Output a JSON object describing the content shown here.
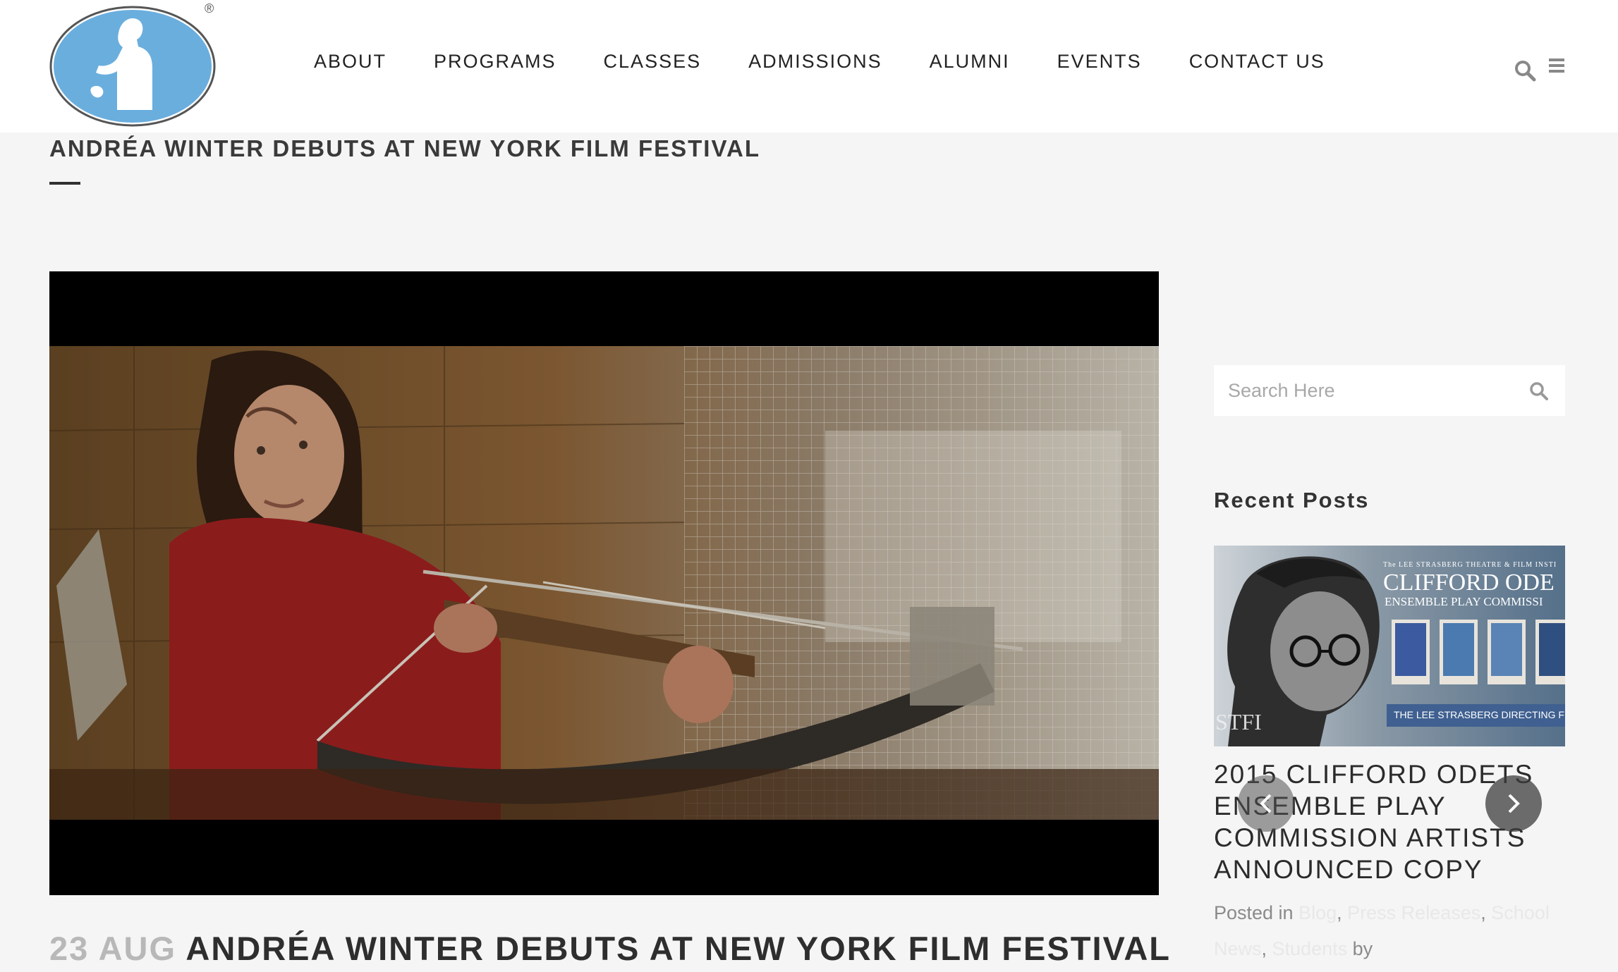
{
  "brand": {
    "logo_registered_mark": "®",
    "accent_color": "#6aaede"
  },
  "nav": {
    "items": [
      {
        "label": "ABOUT"
      },
      {
        "label": "PROGRAMS"
      },
      {
        "label": "CLASSES"
      },
      {
        "label": "ADMISSIONS"
      },
      {
        "label": "ALUMNI"
      },
      {
        "label": "EVENTS"
      },
      {
        "label": "CONTACT US"
      }
    ],
    "search_icon": "search-icon",
    "menu_icon": "hamburger-menu-icon"
  },
  "page": {
    "title": "ANDRÉA WINTER DEBUTS AT NEW YORK FILM FESTIVAL"
  },
  "post": {
    "date_day": "23 AUG",
    "title": "ANDRÉA WINTER DEBUTS AT NEW YORK FILM FESTIVAL"
  },
  "sidebar": {
    "search": {
      "placeholder": "Search Here"
    },
    "recent_posts": {
      "heading": "Recent Posts",
      "thumb": {
        "headline": "CLIFFORD ODE",
        "subheadline": "ENSEMBLE PLAY COMMISSI",
        "banner": "THE LEE STRASBERG DIRECTING FELLOWS",
        "org_small": "The LEE STRASBERG THEATRE & FILM INSTI",
        "watermark": "STFI"
      },
      "item_title": "2015 CLIFFORD ODETS ENSEMBLE PLAY COMMISSION ARTISTS ANNOUNCED COPY",
      "meta_prefix": "Posted in",
      "categories": [
        "Blog",
        "Press Releases",
        "School News",
        "Students"
      ],
      "meta_suffix": "by"
    }
  }
}
